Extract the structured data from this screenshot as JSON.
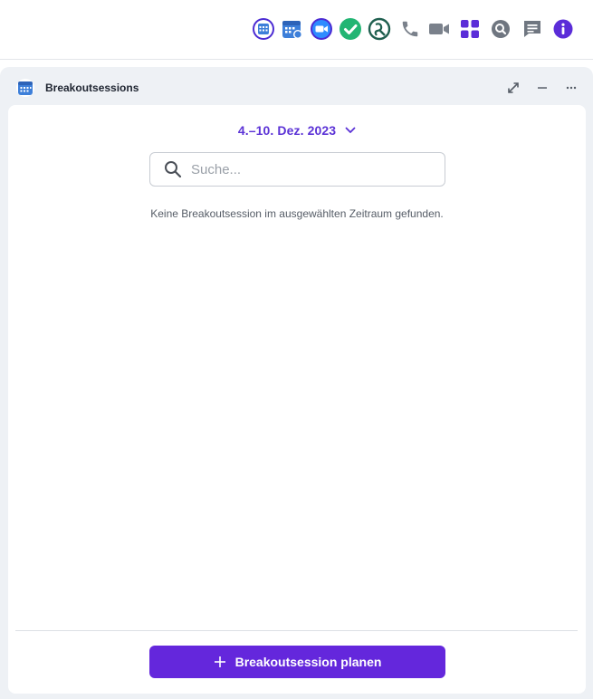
{
  "topbar": {
    "icons": [
      {
        "name": "calendar-grid-icon"
      },
      {
        "name": "calendar-group-icon"
      },
      {
        "name": "video-meeting-icon"
      },
      {
        "name": "checkmark-icon"
      },
      {
        "name": "mechsearch-logo-icon"
      },
      {
        "name": "phone-icon"
      },
      {
        "name": "video-camera-icon"
      },
      {
        "name": "apps-grid-icon"
      },
      {
        "name": "search-icon"
      },
      {
        "name": "chat-icon"
      },
      {
        "name": "info-icon"
      }
    ]
  },
  "panel": {
    "title": "Breakoutsessions",
    "date_range": "4.–10. Dez. 2023",
    "search_placeholder": "Suche...",
    "empty_message": "Keine Breakoutsession im ausgewählten Zeitraum gefunden.",
    "primary_button_label": "Breakoutsession planen"
  },
  "colors": {
    "accent": "#6427dc",
    "date_text": "#5b32d6",
    "panel_bg": "#eef1f5",
    "green": "#22b573",
    "icon_blue": "#3d7fd9"
  }
}
